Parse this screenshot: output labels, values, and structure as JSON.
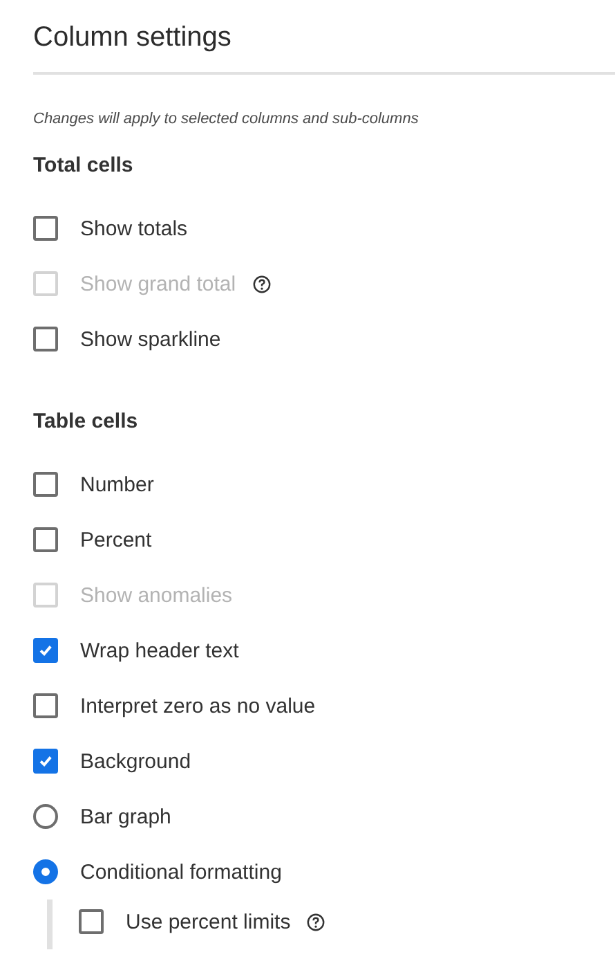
{
  "panel": {
    "title": "Column settings",
    "note": "Changes will apply to selected columns and sub-columns",
    "sections": [
      {
        "heading": "Total cells",
        "items": [
          {
            "kind": "checkbox",
            "label": "Show totals",
            "checked": false,
            "disabled": false,
            "help": false
          },
          {
            "kind": "checkbox",
            "label": "Show grand total",
            "checked": false,
            "disabled": true,
            "help": true
          },
          {
            "kind": "checkbox",
            "label": "Show sparkline",
            "checked": false,
            "disabled": false,
            "help": false
          }
        ]
      },
      {
        "heading": "Table cells",
        "items": [
          {
            "kind": "checkbox",
            "label": "Number",
            "checked": false,
            "disabled": false,
            "help": false
          },
          {
            "kind": "checkbox",
            "label": "Percent",
            "checked": false,
            "disabled": false,
            "help": false
          },
          {
            "kind": "checkbox",
            "label": "Show anomalies",
            "checked": false,
            "disabled": true,
            "help": false
          },
          {
            "kind": "checkbox",
            "label": "Wrap header text",
            "checked": true,
            "disabled": false,
            "help": false
          },
          {
            "kind": "checkbox",
            "label": "Interpret zero as no value",
            "checked": false,
            "disabled": false,
            "help": false
          },
          {
            "kind": "checkbox",
            "label": "Background",
            "checked": true,
            "disabled": false,
            "help": false
          },
          {
            "kind": "radio",
            "label": "Bar graph",
            "selected": false,
            "disabled": false,
            "help": false
          },
          {
            "kind": "radio",
            "label": "Conditional formatting",
            "selected": true,
            "disabled": false,
            "help": false,
            "children": [
              {
                "kind": "checkbox",
                "label": "Use percent limits",
                "checked": false,
                "disabled": false,
                "help": true
              }
            ]
          }
        ]
      }
    ]
  }
}
